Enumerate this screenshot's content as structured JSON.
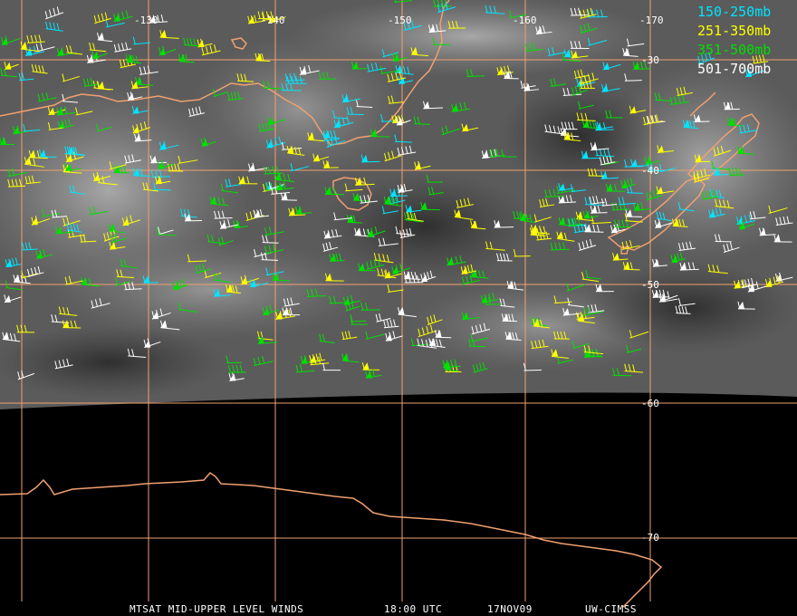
{
  "colors": {
    "grid": "#f0a070",
    "coast": "#f0a070",
    "layer_150_250": "#00e5ff",
    "layer_251_350": "#ffff00",
    "layer_351_500": "#00e000",
    "layer_501_700": "#ffffff"
  },
  "legend": [
    {
      "label": "150-250mb",
      "color": "#00e5ff"
    },
    {
      "label": "251-350mb",
      "color": "#ffff00"
    },
    {
      "label": "351-500mb",
      "color": "#00e000"
    },
    {
      "label": "501-700mb",
      "color": "#ffffff"
    }
  ],
  "longitude_labels": [
    "-130",
    "-140",
    "-150",
    "-160",
    "-170"
  ],
  "latitude_labels": [
    "-30",
    "-40",
    "-50",
    "-60",
    "-70"
  ],
  "footer": {
    "product": "MTSAT MID-UPPER LEVEL WINDS",
    "time": "18:00 UTC",
    "date": "17NOV09",
    "source": "UW-CIMSS"
  }
}
